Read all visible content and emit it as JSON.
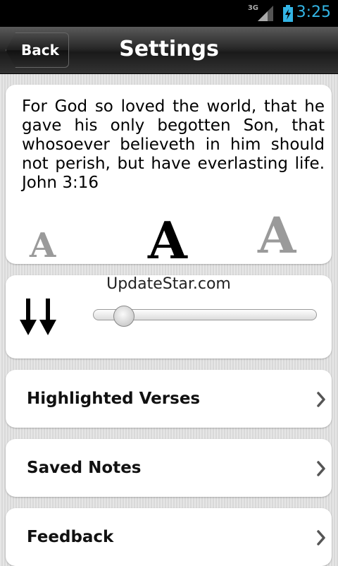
{
  "status_bar": {
    "network": "3G",
    "time": "3:25"
  },
  "header": {
    "back_label": "Back",
    "title": "Settings"
  },
  "font_preview": {
    "verse": "For God so loved the world, that he gave his only begotten Son, that whosoever believeth in him should not perish, but have everlasting life. John 3:16",
    "size_options": [
      "A",
      "A",
      "A"
    ],
    "selected_size": "medium"
  },
  "scroll_speed": {
    "watermark": "UpdateStar.com",
    "slider_value": 0.1,
    "icon": "double-down-arrow-icon"
  },
  "menu": {
    "items": [
      {
        "label": "Highlighted Verses",
        "icon": "chevron-right-icon"
      },
      {
        "label": "Saved Notes",
        "icon": "chevron-right-icon"
      },
      {
        "label": "Feedback",
        "icon": "chevron-right-icon"
      }
    ]
  }
}
